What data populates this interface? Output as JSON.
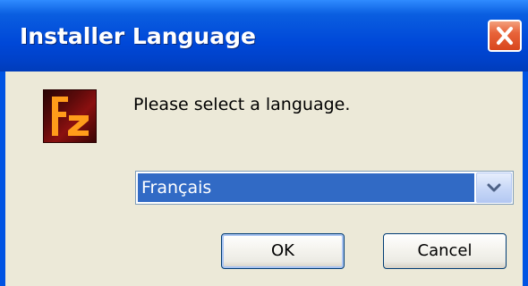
{
  "window": {
    "title": "Installer Language"
  },
  "dialog": {
    "prompt": "Please select a language.",
    "app_icon_letters": "FZ",
    "language_select": {
      "selected": "Français"
    },
    "buttons": {
      "ok": "OK",
      "cancel": "Cancel"
    }
  },
  "icons": {
    "close": "close-icon",
    "app": "filezilla-logo-icon",
    "dropdown": "chevron-down-icon"
  },
  "colors": {
    "titlebar_blue": "#0054e3",
    "close_red": "#e8643a",
    "dialog_face": "#ece9d8",
    "selection_blue": "#316ac5",
    "icon_orange": "#ff9c1a"
  }
}
